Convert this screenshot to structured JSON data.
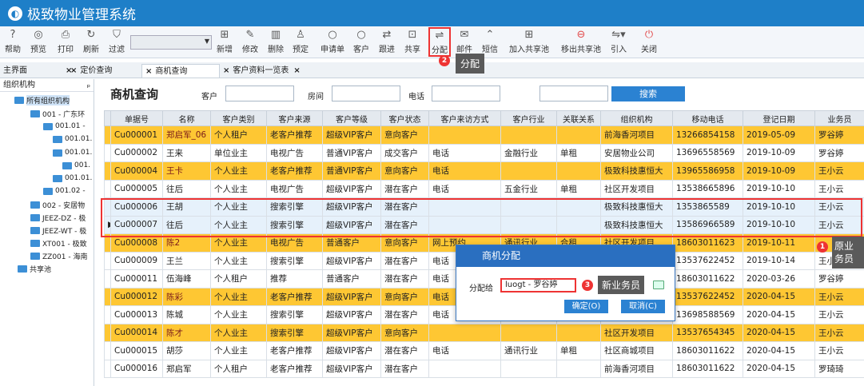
{
  "app": {
    "title": "极致物业管理系统",
    "logo_glyph": "◐"
  },
  "toolbar": {
    "help": "帮助",
    "preview": "预览",
    "print": "打印",
    "refresh": "刷新",
    "filter": "过滤",
    "add": "新增",
    "edit": "修改",
    "delete": "删除",
    "reserve": "预定",
    "apply": "申请单",
    "customer": "客户",
    "follow": "跟进",
    "share": "共享",
    "assign": "分配",
    "mail": "邮件",
    "sms": "短信",
    "join_pool": "加入共享池",
    "leave_pool": "移出共享池",
    "import": "引入",
    "close": "关闭"
  },
  "tabs": [
    "主界面",
    "定价查询",
    "商机查询",
    "客户资料一览表"
  ],
  "sidebar": {
    "header": "组织机构",
    "items": [
      "所有组织机构",
      "001 - 广东环",
      "001.01 -",
      "001.01.",
      "001.01.",
      "001.",
      "001.01.",
      "001.02 -",
      "002 - 安居物",
      "JEEZ-DZ - 极",
      "JEEZ-WT - 极",
      "XT001 - 极致",
      "ZZ001 - 海南",
      "共享池"
    ]
  },
  "filter": {
    "title": "商机查询",
    "customer_label": "客户",
    "room_label": "房间",
    "phone_label": "电话",
    "search_button": "搜索"
  },
  "table": {
    "columns": [
      "单据号",
      "名称",
      "客户类别",
      "客户来源",
      "客户等级",
      "客户状态",
      "客户来访方式",
      "客户行业",
      "关联关系",
      "组织机构",
      "移动电话",
      "登记日期",
      "业务员"
    ],
    "rows": [
      {
        "style": "yellow",
        "cells": [
          "Cu000001",
          "郑启军_06",
          "个人租户",
          "老客户推荐",
          "超级VIP客户",
          "意向客户",
          "",
          "",
          "",
          "前海香河项目",
          "13266854158",
          "2019-05-09",
          "罗谷婷"
        ]
      },
      {
        "style": "white",
        "cells": [
          "Cu000002",
          "王来",
          "单位业主",
          "电视广告",
          "普通VIP客户",
          "成交客户",
          "电话",
          "金融行业",
          "单租",
          "安居物业公司",
          "13696558569",
          "2019-10-09",
          "罗谷婷"
        ]
      },
      {
        "style": "yellow",
        "cells": [
          "Cu000004",
          "王卡",
          "个人业主",
          "老客户推荐",
          "普通VIP客户",
          "意向客户",
          "电话",
          "",
          "",
          "极致科技惠恒大",
          "13965586958",
          "2019-10-09",
          "王小云"
        ]
      },
      {
        "style": "white",
        "cells": [
          "Cu000005",
          "往后",
          "个人业主",
          "电视广告",
          "超级VIP客户",
          "潜在客户",
          "电话",
          "五金行业",
          "单租",
          "社区开发项目",
          "13538665896",
          "2019-10-10",
          "王小云"
        ]
      },
      {
        "style": "blue",
        "cells": [
          "Cu000006",
          "王胡",
          "个人业主",
          "搜索引擎",
          "超级VIP客户",
          "潜在客户",
          "",
          "",
          "",
          "极致科技惠恒大",
          "1353865589",
          "2019-10-10",
          "王小云"
        ]
      },
      {
        "style": "blue",
        "cells": [
          "Cu000007",
          "往后",
          "个人业主",
          "搜索引擎",
          "超级VIP客户",
          "潜在客户",
          "",
          "",
          "",
          "极致科技惠恒大",
          "13586966589",
          "2019-10-10",
          "王小云"
        ]
      },
      {
        "style": "yellow",
        "cells": [
          "Cu000008",
          "陈2",
          "个人业主",
          "电视广告",
          "普通客户",
          "意向客户",
          "网上预约",
          "通讯行业",
          "合租",
          "社区开发项目",
          "18603011623",
          "2019-10-11",
          ""
        ]
      },
      {
        "style": "white",
        "cells": [
          "Cu000009",
          "王兰",
          "个人业主",
          "搜索引擎",
          "超级VIP客户",
          "潜在客户",
          "电话",
          "",
          "",
          "",
          "13537622452",
          "2019-10-14",
          "王小云"
        ]
      },
      {
        "style": "white",
        "cells": [
          "Cu000011",
          "伍海峰",
          "个人租户",
          "推荐",
          "普通客户",
          "潜在客户",
          "电话",
          "",
          "",
          "",
          "18603011622",
          "2020-03-26",
          "罗谷婷"
        ]
      },
      {
        "style": "yellow",
        "cells": [
          "Cu000012",
          "陈彩",
          "个人业主",
          "老客户推荐",
          "超级VIP客户",
          "意向客户",
          "电话",
          "",
          "",
          "",
          "13537622452",
          "2020-04-15",
          "王小云"
        ]
      },
      {
        "style": "white",
        "cells": [
          "Cu000013",
          "陈城",
          "个人业主",
          "搜索引擎",
          "超级VIP客户",
          "潜在客户",
          "电话",
          "",
          "",
          "",
          "13698588569",
          "2020-04-15",
          "王小云"
        ]
      },
      {
        "style": "yellow",
        "cells": [
          "Cu000014",
          "陈才",
          "个人业主",
          "搜索引擎",
          "超级VIP客户",
          "意向客户",
          "",
          "",
          "",
          "社区开发项目",
          "13537654345",
          "2020-04-15",
          "王小云"
        ]
      },
      {
        "style": "white",
        "cells": [
          "Cu000015",
          "胡莎",
          "个人业主",
          "老客户推荐",
          "超级VIP客户",
          "潜在客户",
          "电话",
          "通讯行业",
          "单租",
          "社区商城项目",
          "18603011622",
          "2020-04-15",
          "王小云"
        ]
      },
      {
        "style": "white",
        "cells": [
          "Cu000016",
          "郑启军",
          "个人租户",
          "老客户推荐",
          "超级VIP客户",
          "潜在客户",
          "",
          "",
          "",
          "前海香河项目",
          "18603011622",
          "2020-04-15",
          "罗琦琦"
        ]
      }
    ]
  },
  "dialog": {
    "title": "商机分配",
    "assign_to_label": "分配给",
    "assign_to_value": "luogt - 罗谷婷",
    "ok_button": "确定(O)",
    "cancel_button": "取消(C)"
  },
  "annotations": {
    "badge1": "1",
    "badge2": "2",
    "badge3": "3",
    "tip_assign": "分配",
    "tip_new_salesman": "新业务员",
    "tip_original_salesman": "原业务员"
  }
}
